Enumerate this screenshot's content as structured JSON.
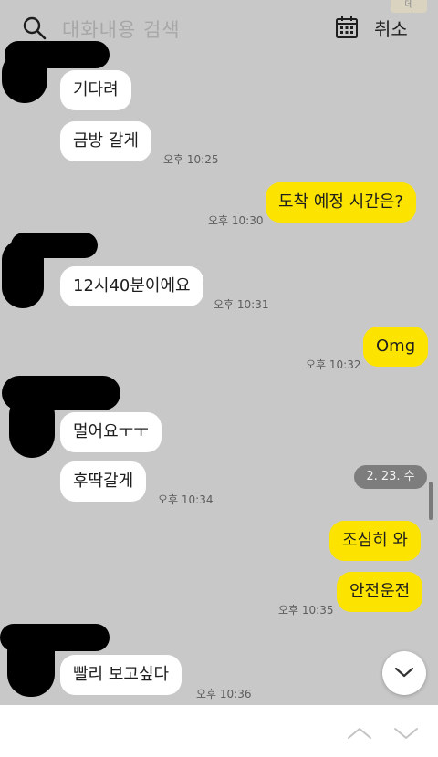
{
  "search": {
    "placeholder": "대화내용 검색",
    "cancel_label": "취소",
    "corner_tag": "데"
  },
  "messages": [
    {
      "text": "기다려",
      "side": "in"
    },
    {
      "text": "금방 갈게",
      "side": "in",
      "time": "오후 10:25"
    },
    {
      "text": "도착 예정 시간은?",
      "side": "out",
      "time": "오후 10:30"
    },
    {
      "text": "12시40분이에요",
      "side": "in",
      "time": "오후 10:31"
    },
    {
      "text": "Omg",
      "side": "out",
      "time": "오후 10:32"
    },
    {
      "text": "멀어요ㅜㅜ",
      "side": "in"
    },
    {
      "text": "후딱갈게",
      "side": "in",
      "time": "오후 10:34"
    },
    {
      "text": "조심히 와",
      "side": "out"
    },
    {
      "text": "안전운전",
      "side": "out",
      "time": "오후 10:35"
    },
    {
      "text": "빨리 보고싶다",
      "side": "in",
      "time": "오후 10:36"
    }
  ],
  "date_indicator": "2. 23. 수",
  "colors": {
    "chat_background": "#c8c8c8",
    "incoming_bubble": "#ffffff",
    "outgoing_bubble": "#fde400",
    "footer": "#ffffff"
  },
  "icons": [
    "search-icon",
    "calendar-icon",
    "chevron-down-icon",
    "chevron-up-icon"
  ]
}
